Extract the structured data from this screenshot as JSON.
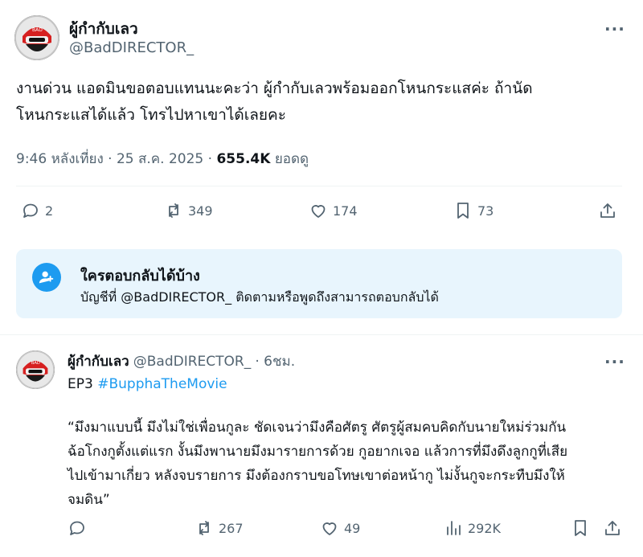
{
  "main_tweet": {
    "author_name": "ผู้กำกับเลว",
    "author_handle": "@BadDIRECTOR_",
    "more_label": "···",
    "text": "งานด่วน แอดมินขอตอบแทนนะคะว่า ผู้กำกับเลวพร้อมออกโหนกระแสค่ะ ถ้านัด\nโหนกระแสได้แล้ว โทรไปหาเขาได้เลยคะ",
    "time": "9:46 หลังเที่ยง · 25 ส.ค. 2025 · ",
    "views": "655.4K",
    "views_label": " ยอดดู",
    "actions": {
      "replies": "2",
      "reposts": "349",
      "likes": "174",
      "bookmarks": "73"
    }
  },
  "who_can_reply": {
    "title": "ใครตอบกลับได้บ้าง",
    "subtitle": "บัญชีที่ @BadDIRECTOR_ ติดตามหรือพูดถึงสามารถตอบกลับได้"
  },
  "reply_tweet": {
    "author_name": "ผู้กำกับเลว",
    "author_handle": "@BadDIRECTOR_",
    "time": "· 6ชม.",
    "more_label": "···",
    "prefix": "EP3 ",
    "hashtag": "#BupphaTheMovie",
    "quote": "“มึงมาแบบนี้ มึงไม่ใช่เพื่อนกูละ ชัดเจนว่ามึงคือศัตรู ศัตรูผู้สมคบคิดกับนายใหม่ร่วมกัน\nฉ้อโกงกูตั้งแต่แรก งั้นมึงพานายมึงมารายการด้วย กูอยากเจอ แล้วการที่มึงดึงลูกกูที่เสีย\nไปเข้ามาเกี่ยว หลังจบรายการ มึงต้องกราบขอโทษเขาต่อหน้ากู ไม่งั้นกูจะกระทืบมึงให้\nจมดิน”",
    "actions": {
      "reposts": "267",
      "likes": "49",
      "views": "292K"
    }
  },
  "colors": {
    "accent": "#1d9bf0",
    "text_secondary": "#536471",
    "info_box": "#e8f5fd"
  },
  "icons": [
    "avatar-helmet",
    "more-icon",
    "reply-icon",
    "repost-icon",
    "like-icon",
    "bookmark-icon",
    "share-icon",
    "people-icon",
    "views-icon"
  ]
}
